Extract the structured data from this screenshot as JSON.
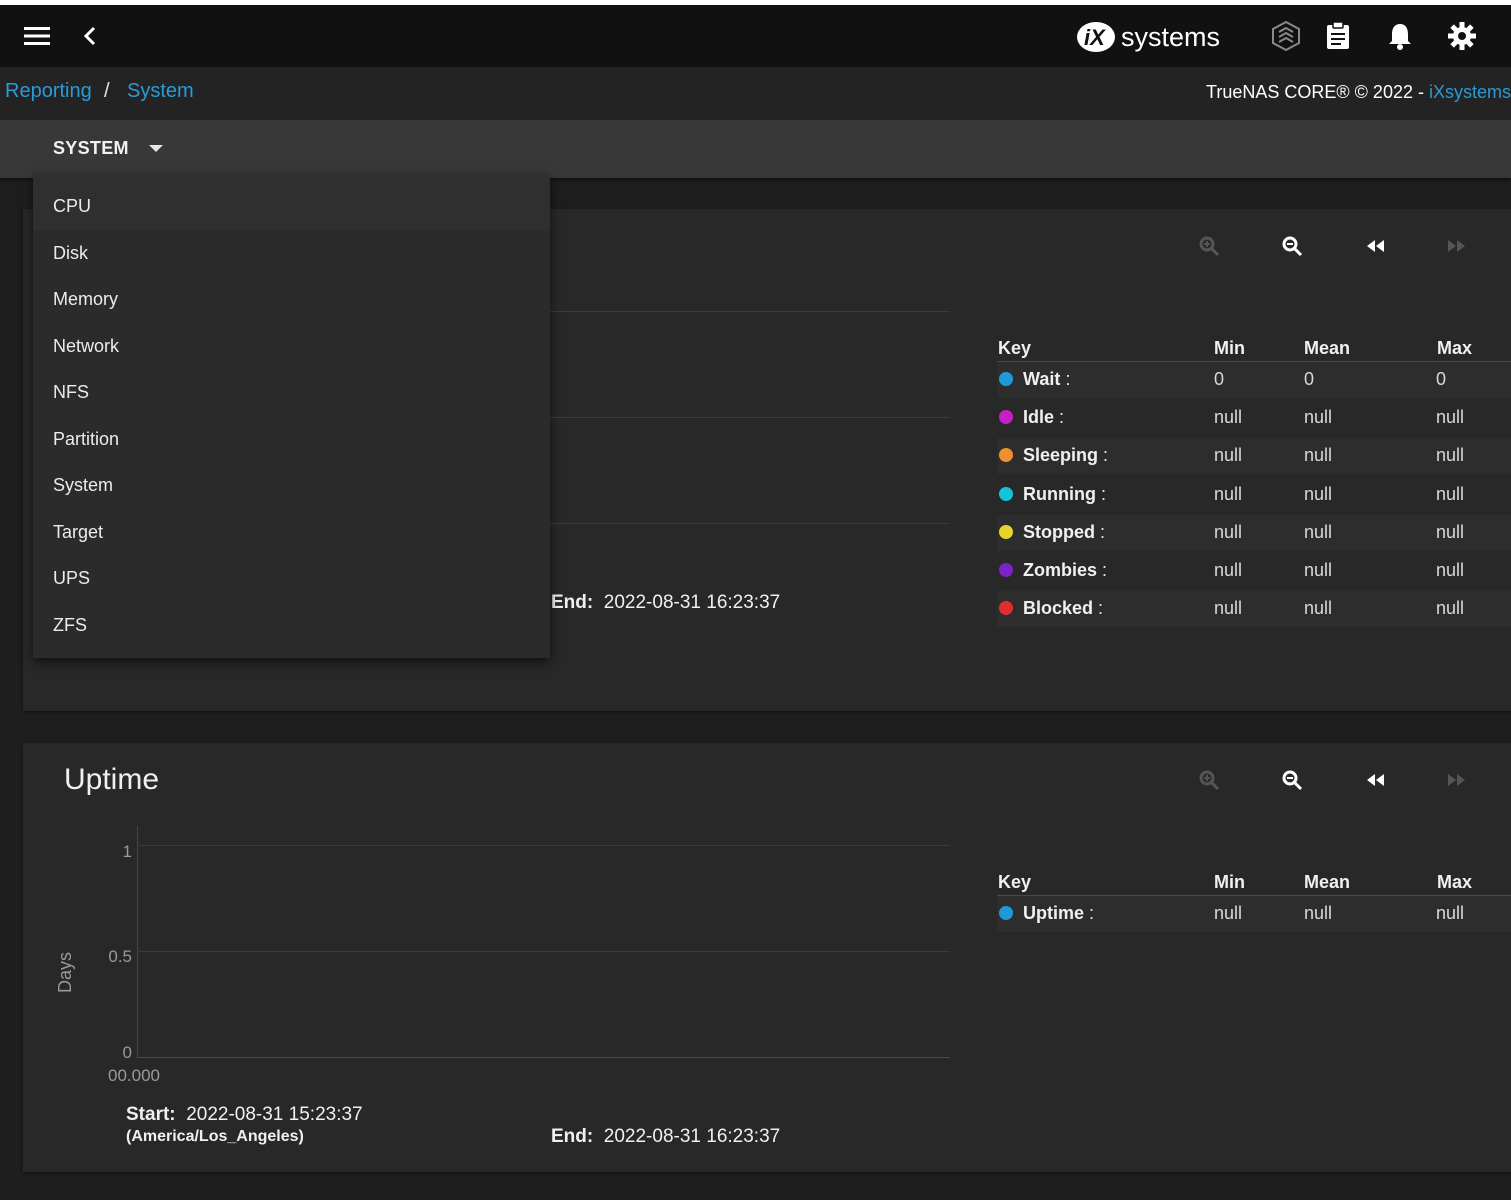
{
  "topbar": {
    "brand": "iXsystems",
    "brand_prefix": "iX",
    "brand_suffix": "systems"
  },
  "breadcrumb": {
    "items": [
      "Reporting",
      "System"
    ],
    "separator": "/"
  },
  "copyright": {
    "text": "TrueNAS CORE® © 2022 - ",
    "link": "iXsystems"
  },
  "toolbar": {
    "selected": "SYSTEM"
  },
  "dropdown": {
    "items": [
      "CPU",
      "Disk",
      "Memory",
      "Network",
      "NFS",
      "Partition",
      "System",
      "Target",
      "UPS",
      "ZFS"
    ]
  },
  "processes_card": {
    "end_label": "End:",
    "end_value": "2022-08-31 16:23:37",
    "legend": {
      "headers": [
        "Key",
        "Min",
        "Mean",
        "Max"
      ],
      "rows": [
        {
          "name": "Wait",
          "color": "#1e9bd7",
          "min": "0",
          "mean": "0",
          "max": "0"
        },
        {
          "name": "Idle",
          "color": "#c81ec8",
          "min": "null",
          "mean": "null",
          "max": "null"
        },
        {
          "name": "Sleeping",
          "color": "#ef8f2e",
          "min": "null",
          "mean": "null",
          "max": "null"
        },
        {
          "name": "Running",
          "color": "#12c4d6",
          "min": "null",
          "mean": "null",
          "max": "null"
        },
        {
          "name": "Stopped",
          "color": "#e6d42a",
          "min": "null",
          "mean": "null",
          "max": "null"
        },
        {
          "name": "Zombies",
          "color": "#7b22c8",
          "min": "null",
          "mean": "null",
          "max": "null"
        },
        {
          "name": "Blocked",
          "color": "#e02e2e",
          "min": "null",
          "mean": "null",
          "max": "null"
        }
      ]
    }
  },
  "uptime_card": {
    "title": "Uptime",
    "y_axis_label": "Days",
    "y_ticks": [
      "1",
      "0.5",
      "0"
    ],
    "x_tick": "00.000",
    "start_label": "Start:",
    "start_value": "2022-08-31 15:23:37",
    "timezone": "(America/Los_Angeles)",
    "end_label": "End:",
    "end_value": "2022-08-31 16:23:37",
    "legend": {
      "headers": [
        "Key",
        "Min",
        "Mean",
        "Max"
      ],
      "rows": [
        {
          "name": "Uptime",
          "color": "#1e9bd7",
          "min": "null",
          "mean": "null",
          "max": "null"
        }
      ]
    }
  },
  "colors": {
    "accent": "#2a9bd8",
    "topbar": "#111111",
    "card": "#282828"
  },
  "icons": [
    "menu-icon",
    "back-icon",
    "truecommand-icon",
    "clipboard-icon",
    "bell-icon",
    "gear-icon",
    "zoom-in-icon",
    "zoom-out-icon",
    "rewind-icon",
    "fast-forward-icon"
  ]
}
